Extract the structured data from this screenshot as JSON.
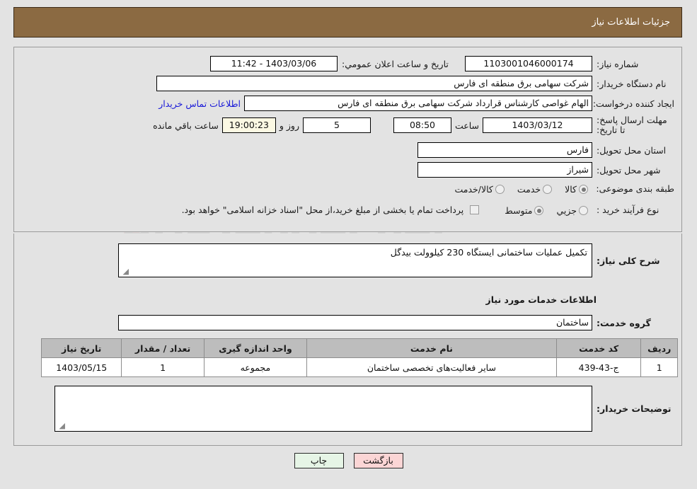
{
  "header": {
    "title": "جزئیات اطلاعات نیاز"
  },
  "watermark": {
    "text": "AriaTender.net"
  },
  "fields": {
    "need_number_label": "شماره نیاز:",
    "need_number_value": "1103001046000174",
    "announce_label": "تاریخ و ساعت اعلان عمومي:",
    "announce_value": "1403/03/06 - 11:42",
    "buyer_org_label": "نام دستگاه خریدار:",
    "buyer_org_value": "شرکت سهامی برق منطقه ای فارس",
    "creator_label": "ایجاد کننده درخواست:",
    "creator_value": "الهام غواصی کارشناس قرارداد شرکت سهامی برق منطقه ای فارس",
    "contact_link": "اطلاعات تماس خریدار",
    "deadline_label": "مهلت ارسال پاسخ: تا تاریخ:",
    "deadline_date": "1403/03/12",
    "hour_label": "ساعت",
    "deadline_time": "08:50",
    "days_remaining": "5",
    "days_word": "روز و",
    "countdown": "19:00:23",
    "remaining_suffix": "ساعت باقي مانده",
    "province_label": "استان محل تحویل:",
    "province_value": "فارس",
    "city_label": "شهر محل تحویل:",
    "city_value": "شیراز",
    "category_label": "طبقه بندی موضوعی:",
    "process_label": "نوع فرآیند خرید :",
    "treasury_note": "پرداخت تمام یا بخشی از مبلغ خرید،از محل \"اسناد خزانه اسلامی\" خواهد بود."
  },
  "category_options": [
    {
      "label": "کالا",
      "selected": true
    },
    {
      "label": "خدمت",
      "selected": false
    },
    {
      "label": "کالا/خدمت",
      "selected": false
    }
  ],
  "process_options": [
    {
      "label": "جزیي",
      "selected": false
    },
    {
      "label": "متوسط",
      "selected": true
    }
  ],
  "description": {
    "label": "شرح کلی نیاز:",
    "value": "تکمیل عملیات ساختمانی ایستگاه 230 کیلوولت بیدگل",
    "section_title": "اطلاعات خدمات مورد نیاز",
    "service_group_label": "گروه خدمت:",
    "service_group_value": "ساختمان"
  },
  "table": {
    "headers": [
      "ردیف",
      "کد خدمت",
      "نام خدمت",
      "واحد اندازه گیری",
      "تعداد / مقدار",
      "تاریخ نیاز"
    ],
    "rows": [
      [
        "1",
        "ج-43-439",
        "سایر فعالیت‌های تخصصی ساختمان",
        "مجموعه",
        "1",
        "1403/05/15"
      ]
    ]
  },
  "buyer_comments": {
    "label": "توضیحات خریدار:",
    "value": ""
  },
  "footer": {
    "print_label": "چاپ",
    "back_label": "بازگشت"
  },
  "colors": {
    "header_bg": "#8b6a42",
    "link": "#1818d8",
    "print_btn": "#e6f5e6",
    "back_btn": "#fbd5d5",
    "countdown_bg": "#fbf8e3"
  }
}
